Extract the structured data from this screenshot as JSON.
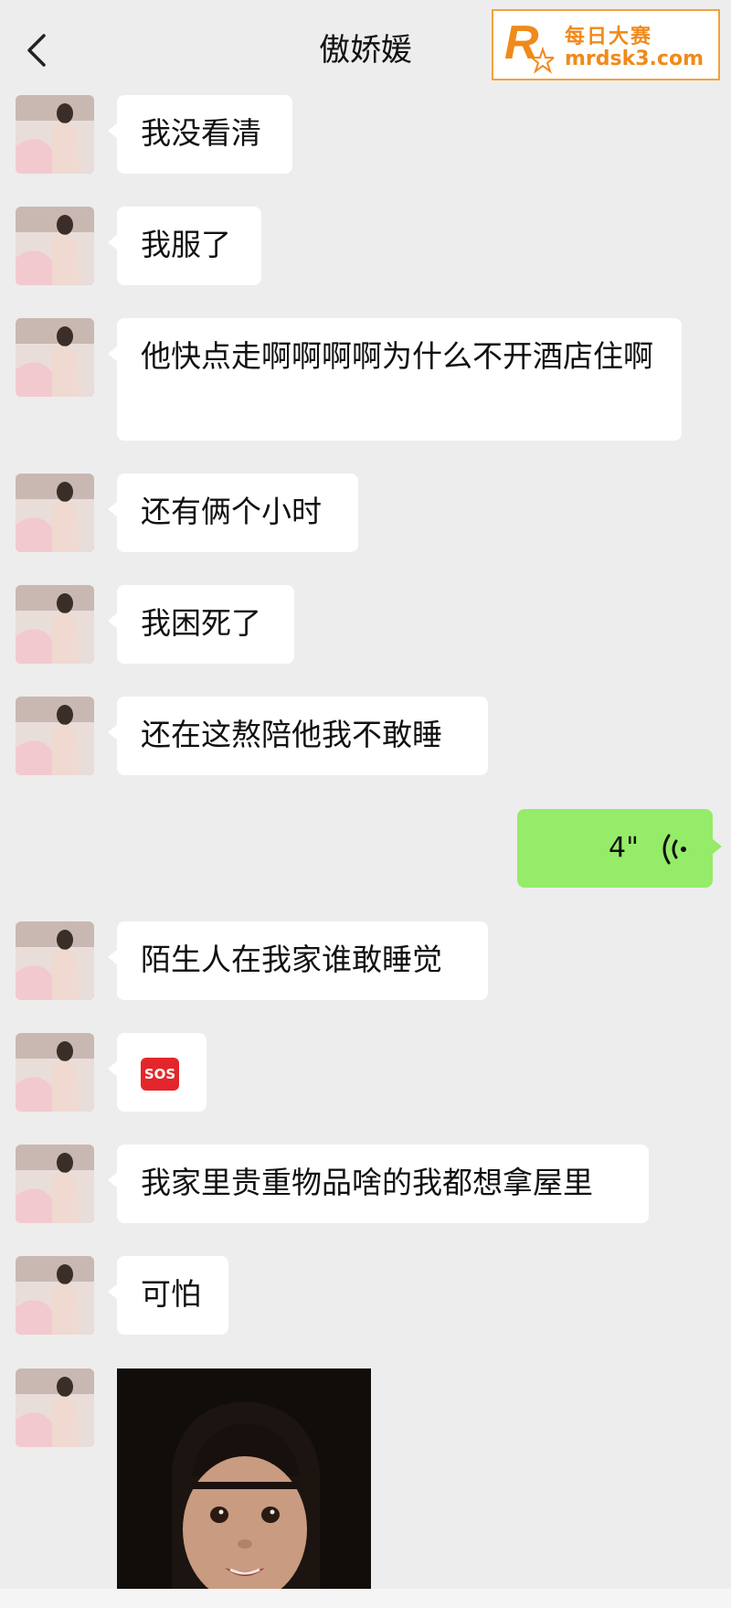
{
  "header": {
    "title": "傲娇媛",
    "back_icon": "chevron-left-icon"
  },
  "watermark": {
    "logo_letter": "R",
    "line1": "每日大赛",
    "line2": "mrdsk3.com"
  },
  "messages": [
    {
      "side": "left",
      "type": "text",
      "text": "我没看清"
    },
    {
      "side": "left",
      "type": "text",
      "text": "我服了"
    },
    {
      "side": "left",
      "type": "text",
      "text": "他快点走啊啊啊啊为什么不开酒店住啊"
    },
    {
      "side": "left",
      "type": "text",
      "text": "还有俩个小时"
    },
    {
      "side": "left",
      "type": "text",
      "text": "我困死了"
    },
    {
      "side": "left",
      "type": "text",
      "text": "还在这熬陪他我不敢睡"
    },
    {
      "side": "right",
      "type": "voice",
      "duration": "4\""
    },
    {
      "side": "left",
      "type": "text",
      "text": "陌生人在我家谁敢睡觉"
    },
    {
      "side": "left",
      "type": "emoji",
      "text": "SOS"
    },
    {
      "side": "left",
      "type": "text",
      "text": "我家里贵重物品啥的我都想拿屋里"
    },
    {
      "side": "left",
      "type": "text",
      "text": "可怕"
    },
    {
      "side": "left",
      "type": "image",
      "description_icon": "child-photo-icon"
    }
  ],
  "colors": {
    "background": "#ededed",
    "bubble_left": "#ffffff",
    "bubble_right": "#95ec69",
    "watermark": "#f08a1a"
  }
}
